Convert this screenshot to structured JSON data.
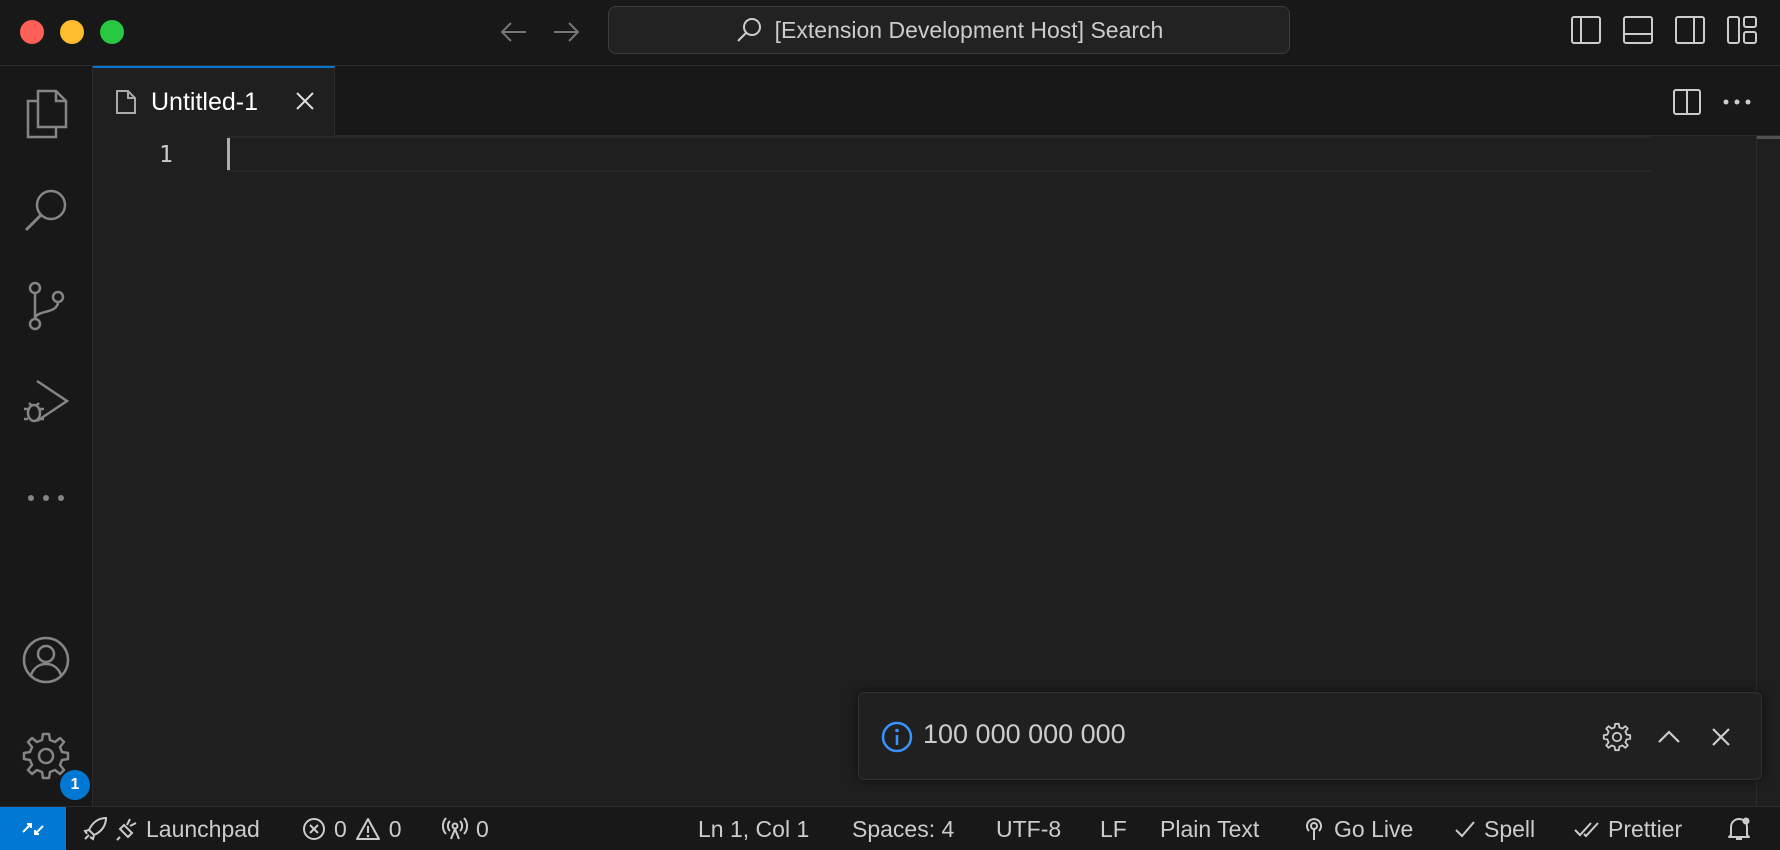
{
  "titlebar": {
    "search_text": "[Extension Development Host] Search"
  },
  "activity_bar": {
    "items": [
      {
        "name": "explorer",
        "icon": "files-icon"
      },
      {
        "name": "search",
        "icon": "search-icon"
      },
      {
        "name": "source-control",
        "icon": "source-control-icon"
      },
      {
        "name": "run-and-debug",
        "icon": "run-debug-icon"
      },
      {
        "name": "more",
        "icon": "ellipsis-icon"
      }
    ],
    "accounts_icon": "account-icon",
    "manage_icon": "gear-icon",
    "manage_badge": "1"
  },
  "tabs": [
    {
      "label": "Untitled-1",
      "icon": "file-icon",
      "active": true
    }
  ],
  "editor": {
    "line_numbers": [
      "1"
    ]
  },
  "notification": {
    "message": "100 000 000 000",
    "icon": "info-icon"
  },
  "statusbar": {
    "launchpad": "Launchpad",
    "errors": "0",
    "warnings": "0",
    "ports": "0",
    "position": "Ln 1, Col 1",
    "spaces": "Spaces: 4",
    "encoding": "UTF-8",
    "eol": "LF",
    "language": "Plain Text",
    "go_live": "Go Live",
    "spell": "Spell",
    "prettier": "Prettier"
  },
  "colors": {
    "accent": "#0078d4",
    "background": "#1f1f1f",
    "chrome": "#181818",
    "info": "#3794ff"
  }
}
